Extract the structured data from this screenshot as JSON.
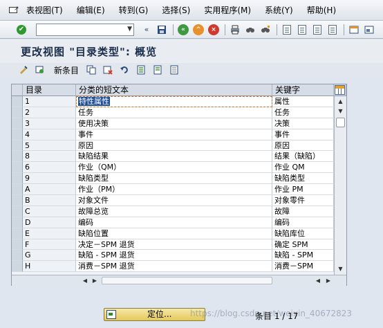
{
  "menu": {
    "items": [
      "表视图(T)",
      "编辑(E)",
      "转到(G)",
      "选择(S)",
      "实用程序(M)",
      "系统(Y)",
      "帮助(H)"
    ]
  },
  "toolbar": {
    "command_value": "",
    "back_glyph": "«"
  },
  "title": "更改视图 \"目录类型\": 概览",
  "app_toolbar": {
    "new_entries": "新条目"
  },
  "table": {
    "headers": [
      "目录",
      "分类的短文本",
      "关键字"
    ],
    "rows": [
      {
        "dir": "1",
        "short": "特性属性",
        "key": "属性"
      },
      {
        "dir": "2",
        "short": "任务",
        "key": "任务"
      },
      {
        "dir": "3",
        "short": "使用决策",
        "key": "决策"
      },
      {
        "dir": "4",
        "short": "事件",
        "key": "事件"
      },
      {
        "dir": "5",
        "short": "原因",
        "key": "原因"
      },
      {
        "dir": "8",
        "short": "缺陷结果",
        "key": "结果（缺陷）"
      },
      {
        "dir": "6",
        "short": "作业（QM）",
        "key": "作业 QM"
      },
      {
        "dir": "9",
        "short": "缺陷类型",
        "key": "缺陷类型"
      },
      {
        "dir": "A",
        "short": "作业（PM）",
        "key": "作业 PM"
      },
      {
        "dir": "B",
        "short": "对象文件",
        "key": "对象零件"
      },
      {
        "dir": "C",
        "short": "故障总览",
        "key": "故障"
      },
      {
        "dir": "D",
        "short": "编码",
        "key": "编码"
      },
      {
        "dir": "E",
        "short": "缺陷位置",
        "key": "缺陷库位"
      },
      {
        "dir": "F",
        "short": "决定－SPM 退货",
        "key": "确定 SPM"
      },
      {
        "dir": "G",
        "short": "缺陷 - SPM 退货",
        "key": "缺陷 - SPM"
      },
      {
        "dir": "H",
        "short": "消费－SPM 退货",
        "key": "消费－SPM"
      }
    ]
  },
  "footer": {
    "locate_label": "定位...",
    "entry_status": "条目 1 / 17",
    "watermark": "https://blog.csdn.net/weixin_40672823"
  }
}
